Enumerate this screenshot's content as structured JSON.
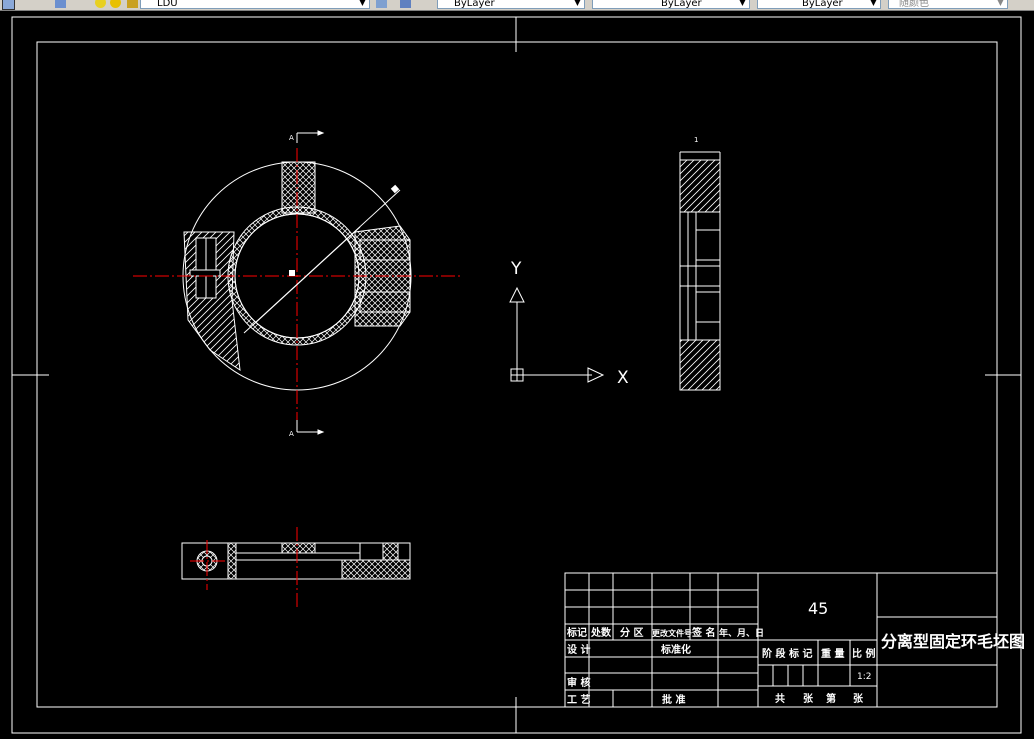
{
  "toolbar": {
    "layer_name": "LDU",
    "color_value": "ByLayer",
    "linetype_value": "ByLayer",
    "lineweight_value": "ByLayer",
    "plotstyle_value": "随颜色"
  },
  "drawing": {
    "axis_y_label": "Y",
    "axis_x_label": "X",
    "section_label": "A",
    "dim_label": "1"
  },
  "title_block": {
    "material": "45",
    "drawing_title": "分离型固定环毛坯图",
    "scale": "1:2",
    "headers": {
      "mark": "标记",
      "count": "处数",
      "zone": "分 区",
      "change_doc": "更改文件号",
      "signature": "签 名",
      "date": "年、月、日"
    },
    "design": "设 计",
    "standardize": "标准化",
    "review": "审 核",
    "process": "工 艺",
    "approve": "批 准",
    "stage_mark": "阶 段 标 记",
    "weight": "重 量",
    "ratio": "比 例",
    "total_sheets": "共",
    "sheet_unit": "张",
    "sheet_no": "第",
    "sheet_unit2": "张"
  },
  "colors": {
    "background": "#000000",
    "line": "#ffffff",
    "center_line": "#ff0000"
  }
}
